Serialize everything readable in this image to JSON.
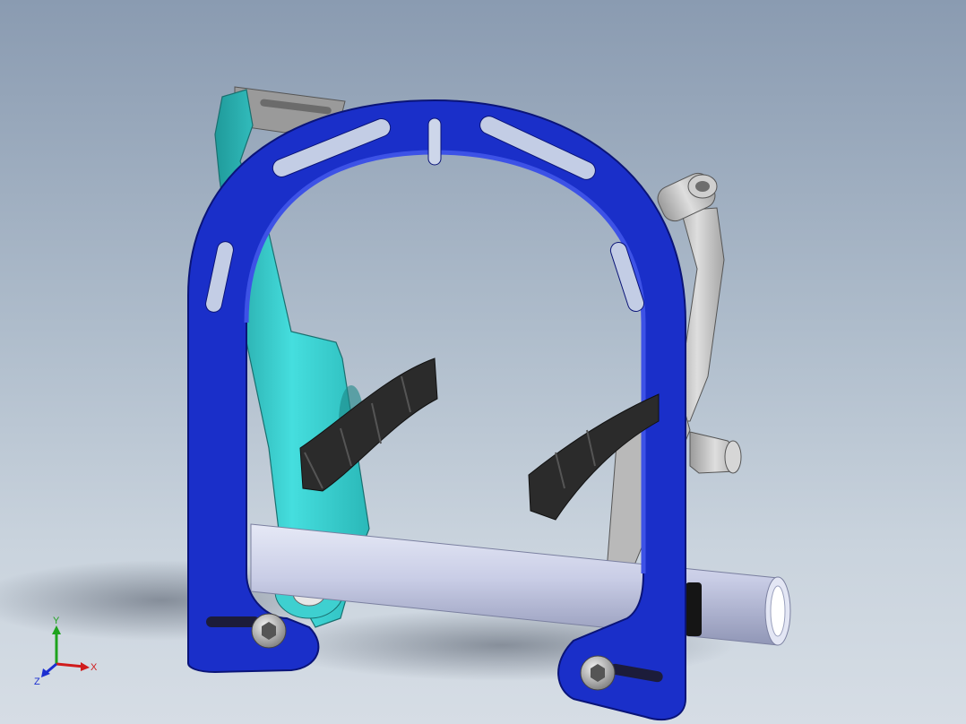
{
  "viewport": {
    "background_top": "#8a9bb1",
    "background_bottom": "#d6dde5"
  },
  "model": {
    "frame_color": "#1a2fc9",
    "arm_left_color": "#3fd6d6",
    "arm_right_color": "#c8c8c8",
    "pad_color": "#2b2b2b",
    "tube_color": "#c9cde6"
  },
  "triad": {
    "x_label": "X",
    "y_label": "Y",
    "z_label": "Z",
    "x_color": "#d01c1c",
    "y_color": "#1ea31e",
    "z_color": "#1c2fd0"
  }
}
